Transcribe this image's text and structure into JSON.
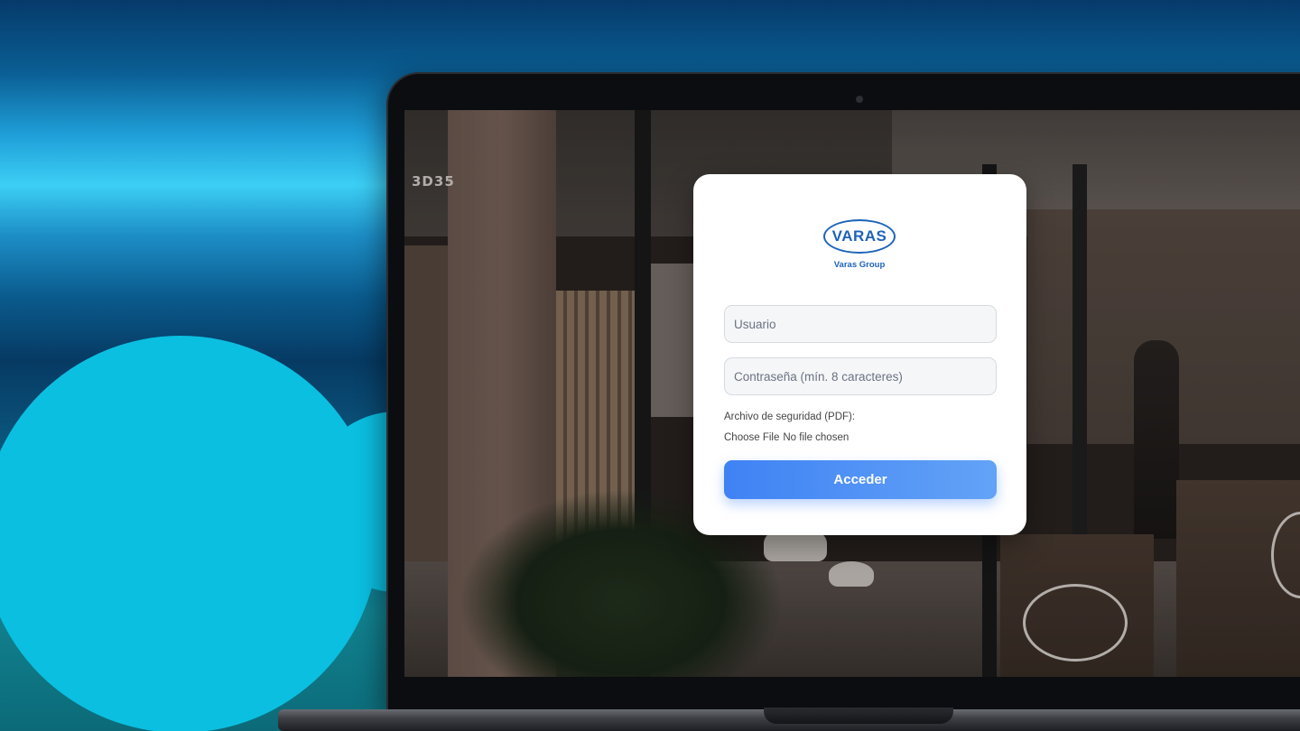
{
  "brand": {
    "name": "VARAS",
    "subtitle": "Varas Group",
    "color": "#1d63b8"
  },
  "scene": {
    "sign_text": "3D35"
  },
  "login": {
    "username_placeholder": "Usuario",
    "password_placeholder": "Contraseña (mín. 8 caracteres)",
    "file_label": "Archivo de seguridad (PDF):",
    "file_button": "Choose File",
    "file_status": "No file chosen",
    "submit_label": "Acceder",
    "accent_color": "#3f82f4"
  }
}
